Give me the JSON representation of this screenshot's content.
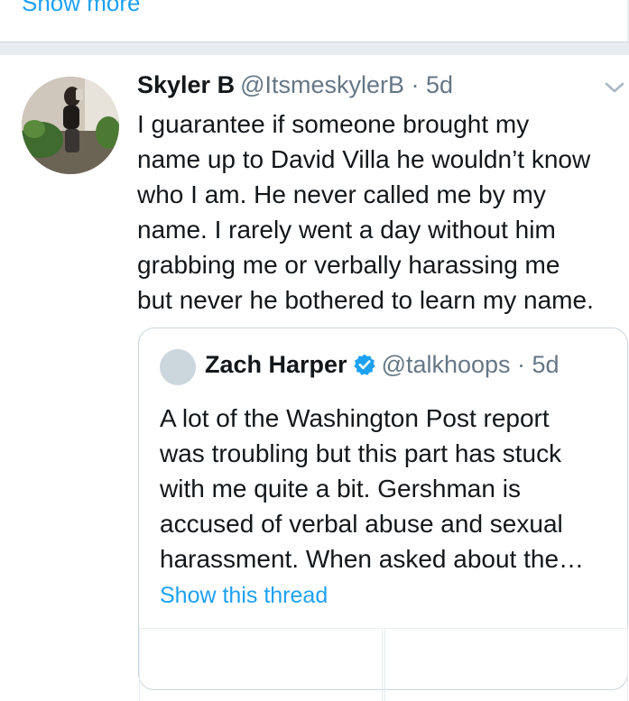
{
  "previous_tweet": {
    "show_more_label": "Show more"
  },
  "tweet": {
    "display_name": "Skyler B",
    "handle_time": "@ItsmeskylerB · 5d",
    "text": "I guarantee if someone brought my\nname up to David Villa he wouldn’t know\nwho I am. He never called me by my\nname. I rarely went a day without him\ngrabbing me or verbally harassing me\nbut never he bothered to learn my name."
  },
  "quoted_tweet": {
    "display_name": "Zach Harper",
    "handle_time": "@talkhoops · 5d",
    "text": "A lot of the Washington Post report\nwas troubling but this part has stuck\nwith me quite a bit. Gershman is\naccused of verbal abuse and sexual\nharassment. When asked about the…",
    "thread_link_label": "Show this thread"
  },
  "icons": {
    "menu": "chevron-down-icon",
    "verified": "verified-badge-icon"
  },
  "colors": {
    "link": "#1da1f2",
    "secondary_text": "#657786",
    "separator": "#e6ecf0",
    "verified": "#1da1f2"
  }
}
